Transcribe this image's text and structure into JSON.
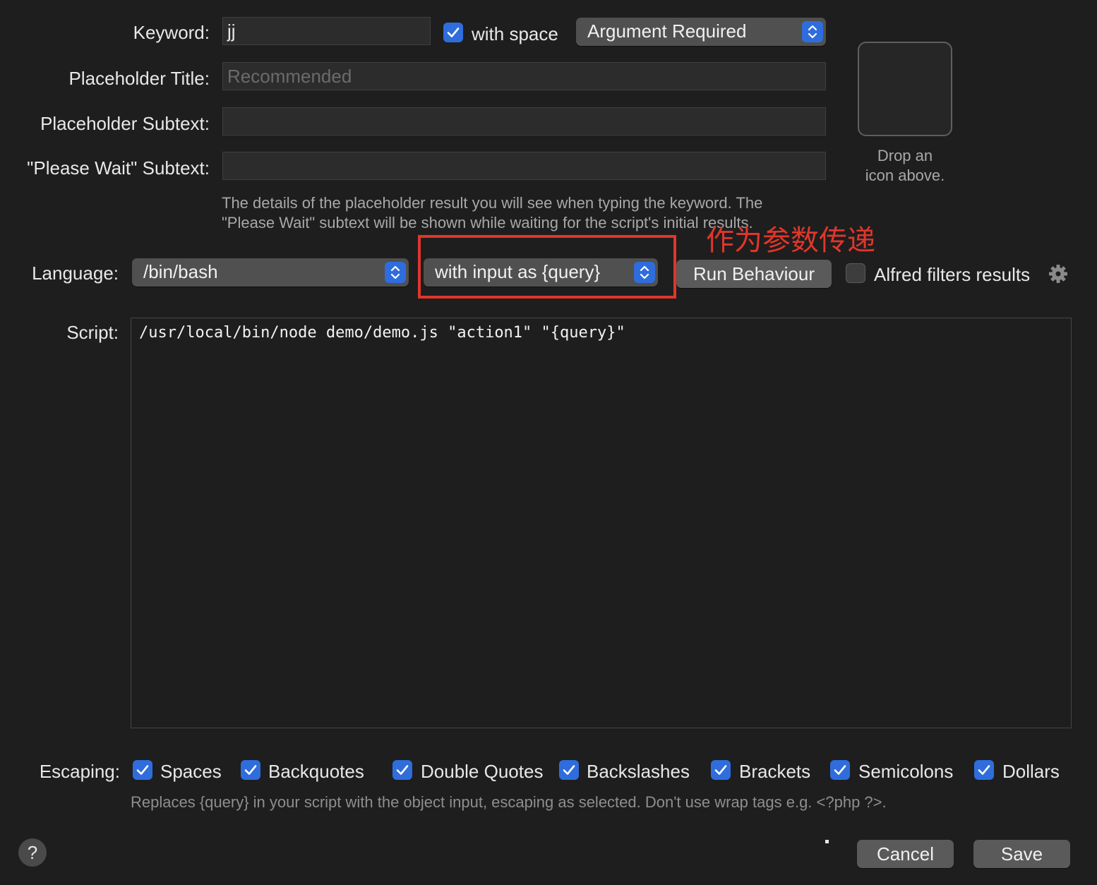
{
  "keyword": {
    "label": "Keyword:",
    "value": "jj"
  },
  "with_space": {
    "label": "with space",
    "checked": true
  },
  "argument_popup": {
    "value": "Argument Required"
  },
  "placeholder_title": {
    "label": "Placeholder Title:",
    "placeholder": "Recommended"
  },
  "placeholder_subtext": {
    "label": "Placeholder Subtext:",
    "value": ""
  },
  "please_wait_subtext": {
    "label": "\"Please Wait\" Subtext:",
    "value": ""
  },
  "icon_well": {
    "hint_line1": "Drop an",
    "hint_line2": "icon above."
  },
  "placeholder_help": {
    "line1": "The details of the placeholder result you will see when typing the keyword. The",
    "line2": "\"Please Wait\" subtext will be shown while waiting for the script's initial results."
  },
  "annotation": {
    "text": "作为参数传递",
    "color": "#e0362b"
  },
  "language": {
    "label": "Language:",
    "value": "/bin/bash"
  },
  "input_mode_popup": {
    "value": "with input as {query}"
  },
  "run_behaviour_button": {
    "label": "Run Behaviour"
  },
  "alfred_filters": {
    "label": "Alfred filters results",
    "checked": false,
    "icon": "gear-icon"
  },
  "script": {
    "label": "Script:",
    "value": "/usr/local/bin/node demo/demo.js \"action1\" \"{query}\""
  },
  "escaping": {
    "label": "Escaping:",
    "options": [
      {
        "label": "Spaces",
        "checked": true
      },
      {
        "label": "Backquotes",
        "checked": true
      },
      {
        "label": "Double Quotes",
        "checked": true
      },
      {
        "label": "Backslashes",
        "checked": true
      },
      {
        "label": "Brackets",
        "checked": true
      },
      {
        "label": "Semicolons",
        "checked": true
      },
      {
        "label": "Dollars",
        "checked": true
      }
    ],
    "help": "Replaces {query} in your script with the object input, escaping as selected. Don't use wrap tags e.g. <?php ?>."
  },
  "help_button": {
    "label": "?"
  },
  "cancel_button": {
    "label": "Cancel"
  },
  "save_button": {
    "label": "Save"
  },
  "colors": {
    "accent": "#2f6ddd",
    "background": "#1e1e1e",
    "annotation": "#e0362b"
  }
}
